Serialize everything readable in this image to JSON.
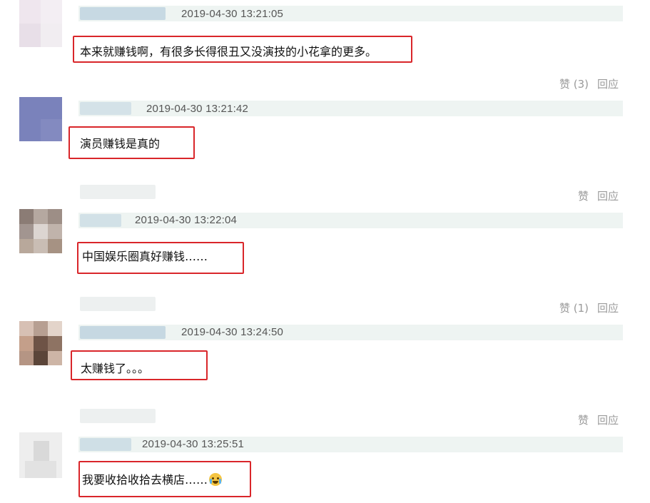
{
  "comments": [
    {
      "timestamp": "2019-04-30 13:21:05",
      "text": "本来就赚钱啊，有很多长得很丑又没演技的小花拿的更多。",
      "like_label": "赞 (3)",
      "reply_label": "回应"
    },
    {
      "timestamp": "2019-04-30 13:21:42",
      "text": "演员赚钱是真的",
      "like_label": "赞",
      "reply_label": "回应"
    },
    {
      "timestamp": "2019-04-30 13:22:04",
      "text": "中国娱乐圈真好赚钱……",
      "like_label": "赞 (1)",
      "reply_label": "回应"
    },
    {
      "timestamp": "2019-04-30 13:24:50",
      "text": "太赚钱了。。。",
      "like_label": "赞",
      "reply_label": "回应"
    },
    {
      "timestamp": "2019-04-30 13:25:51",
      "text": "我要收拾收拾去横店……",
      "emoji": "crying-face"
    }
  ],
  "colors": {
    "highlight_border": "#d9262a",
    "header_bg": "#eef4f2",
    "action_text": "#9a9a9a"
  }
}
